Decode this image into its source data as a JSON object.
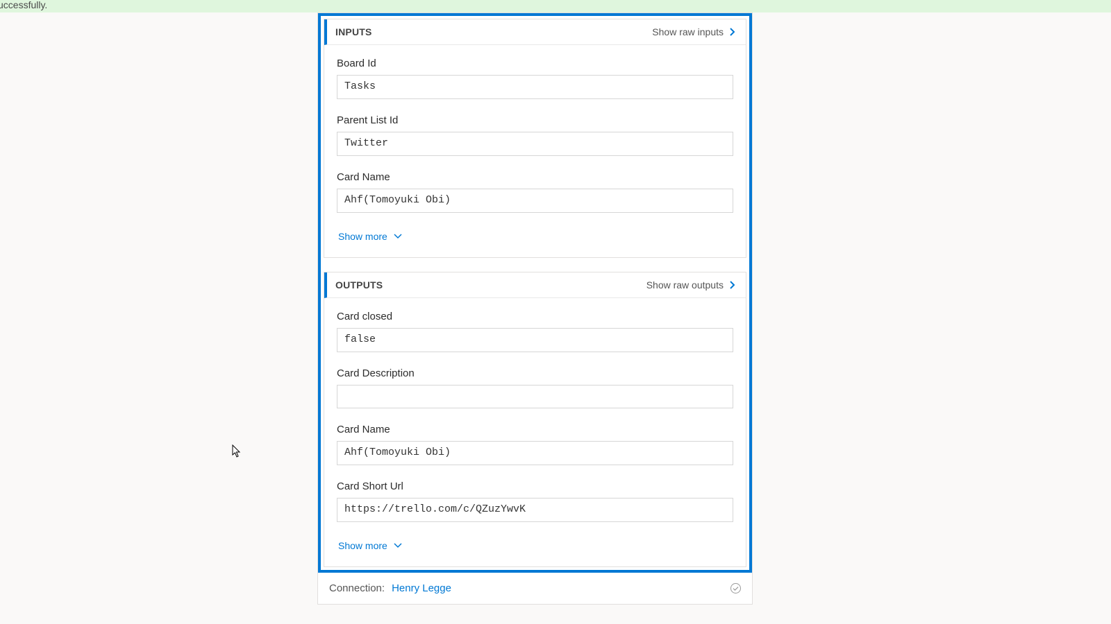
{
  "banner": {
    "text": "successfully."
  },
  "inputs": {
    "title": "INPUTS",
    "rawLink": "Show raw inputs",
    "fields": [
      {
        "label": "Board Id",
        "value": "Tasks"
      },
      {
        "label": "Parent List Id",
        "value": "Twitter"
      },
      {
        "label": "Card Name",
        "value": "Ahf(Tomoyuki Obi)"
      }
    ],
    "showMore": "Show more"
  },
  "outputs": {
    "title": "OUTPUTS",
    "rawLink": "Show raw outputs",
    "fields": [
      {
        "label": "Card closed",
        "value": "false"
      },
      {
        "label": "Card Description",
        "value": ""
      },
      {
        "label": "Card Name",
        "value": "Ahf(Tomoyuki Obi)"
      },
      {
        "label": "Card Short Url",
        "value": "https://trello.com/c/QZuzYwvK"
      }
    ],
    "showMore": "Show more"
  },
  "connection": {
    "label": "Connection:",
    "name": "Henry Legge"
  }
}
